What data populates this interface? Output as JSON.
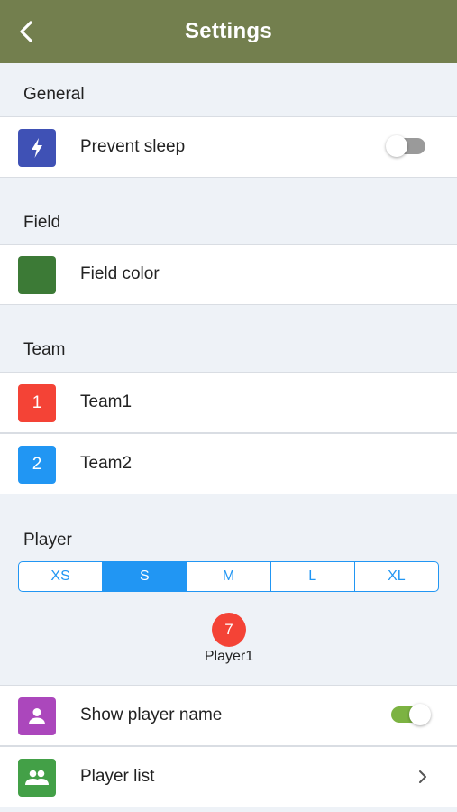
{
  "header": {
    "title": "Settings",
    "back_icon": "chevron-left-icon"
  },
  "sections": {
    "general": "General",
    "field": "Field",
    "team": "Team",
    "player": "Player"
  },
  "general": {
    "prevent_sleep": {
      "label": "Prevent sleep",
      "icon": "lightning-icon",
      "icon_color": "#3f51b5",
      "enabled": false
    }
  },
  "field": {
    "field_color": {
      "label": "Field color",
      "swatch_color": "#3c7a36"
    }
  },
  "team": {
    "items": [
      {
        "number": "1",
        "label": "Team1",
        "color": "#f44336"
      },
      {
        "number": "2",
        "label": "Team2",
        "color": "#2196f3"
      }
    ]
  },
  "player": {
    "sizes": [
      "XS",
      "S",
      "M",
      "L",
      "XL"
    ],
    "selected_size": "S",
    "preview": {
      "number": "7",
      "name": "Player1",
      "color": "#f44336"
    },
    "show_name": {
      "label": "Show player name",
      "icon": "person-icon",
      "icon_color": "#ab47bc",
      "enabled": true
    },
    "list": {
      "label": "Player list",
      "icon": "people-icon",
      "icon_color": "#43a047"
    }
  },
  "colors": {
    "header": "#737f4e",
    "accent": "#2196f3",
    "toggle_on": "#7cb342",
    "toggle_off": "#9a9a9a",
    "background": "#eef2f7"
  }
}
